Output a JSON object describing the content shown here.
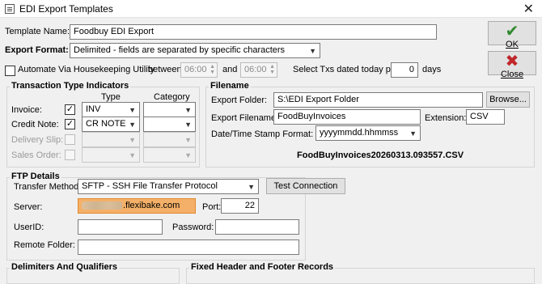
{
  "window": {
    "title": "EDI Export Templates",
    "close_glyph": "✕"
  },
  "template": {
    "label": "Template Name:",
    "value": "Foodbuy EDI Export"
  },
  "export_format": {
    "label": "Export Format:",
    "value": "Delimited - fields are separated by specific characters"
  },
  "automate": {
    "label": "Automate Via Housekeeping Utility",
    "between_label": "between",
    "start_time": "06:00",
    "and_label": "and",
    "end_time": "06:00",
    "select_label": "Select Txs dated today plus",
    "days_value": "0",
    "days_label": "days"
  },
  "buttons": {
    "ok": "OK",
    "close": "Close",
    "browse": "Browse...",
    "test_connection": "Test Connection"
  },
  "transaction": {
    "title": "Transaction Type Indicators",
    "type_header": "Type",
    "category_header": "Category",
    "rows": [
      {
        "label": "Invoice:",
        "checked": "✓",
        "type": "INV",
        "enabled": true
      },
      {
        "label": "Credit Note:",
        "checked": "✓",
        "type": "CR NOTE",
        "enabled": true
      },
      {
        "label": "Delivery Slip:",
        "checked": "",
        "type": "",
        "enabled": false
      },
      {
        "label": "Sales Order:",
        "checked": "",
        "type": "",
        "enabled": false
      }
    ]
  },
  "filename": {
    "title": "Filename",
    "folder_label": "Export Folder:",
    "folder_value": "S:\\EDI Export Folder",
    "file_label": "Export Filename:",
    "file_value": "FoodBuyInvoices",
    "extension_label": "Extension:",
    "extension_value": "CSV",
    "stamp_label": "Date/Time Stamp Format:",
    "stamp_value": "yyyymmdd.hhmmss",
    "preview": "FoodBuyInvoices20260313.093557.CSV"
  },
  "ftp": {
    "title": "FTP Details",
    "method_label": "Transfer Method:",
    "method_value": "SFTP - SSH File Transfer Protocol",
    "server_label": "Server:",
    "server_value": ".flexibake.com",
    "port_label": "Port:",
    "port_value": "22",
    "userid_label": "UserID:",
    "userid_value": "",
    "password_label": "Password:",
    "password_value": "",
    "remote_label": "Remote Folder:",
    "remote_value": ""
  },
  "bottom": {
    "delimiters_title": "Delimiters And Qualifiers",
    "fixed_title": "Fixed Header and Footer Records"
  }
}
